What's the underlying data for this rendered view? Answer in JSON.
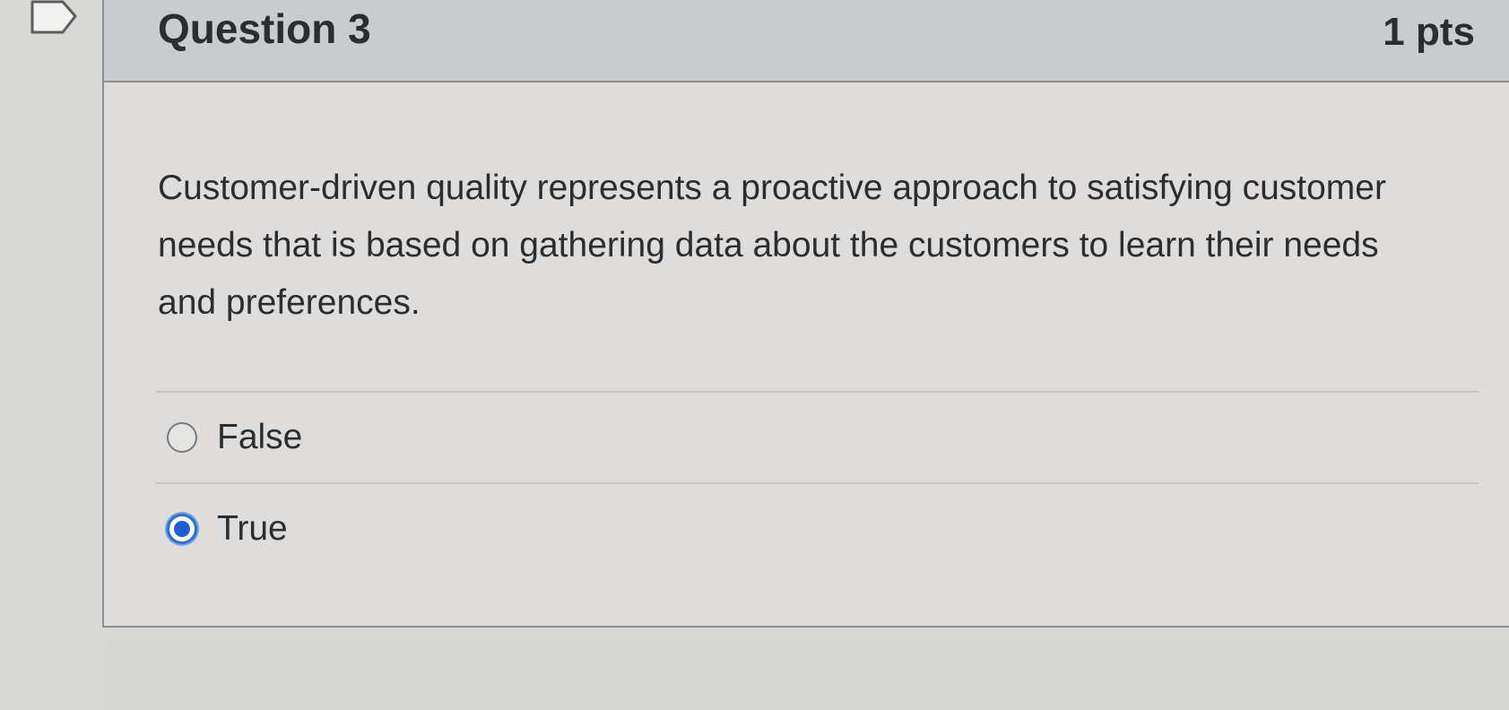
{
  "question": {
    "title": "Question 3",
    "points": "1 pts",
    "text": "Customer-driven quality represents a proactive approach to satisfying customer needs that is based on gathering data about the customers to learn their needs and preferences.",
    "answers": [
      {
        "label": "False",
        "selected": false
      },
      {
        "label": "True",
        "selected": true
      }
    ]
  },
  "colors": {
    "header_bg": "#c9cbcf",
    "selected_radio": "#1b5fd3"
  },
  "icons": {
    "flag": "flag-bookmark-icon"
  }
}
